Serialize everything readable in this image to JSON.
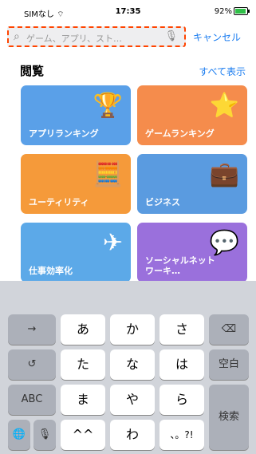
{
  "status": {
    "carrier": "SIMなし",
    "wifi_icon": "wifi-icon",
    "time": "17:35",
    "battery": "92%"
  },
  "search": {
    "placeholder": "ゲーム、アプリ、スト…",
    "cancel_label": "キャンセル"
  },
  "browse": {
    "title": "閲覧",
    "show_all": "すべて表示"
  },
  "categories": [
    {
      "label": "アプリランキング",
      "color": "#5aa0e8"
    },
    {
      "label": "ゲームランキング",
      "color": "#f58c4c"
    },
    {
      "label": "ユーティリティ",
      "color": "#f59a3a"
    },
    {
      "label": "ビジネス",
      "color": "#5a9be0"
    },
    {
      "label": "仕事効率化",
      "color": "#5ca9e8"
    },
    {
      "label": "ソーシャルネットワーキ…",
      "color": "#9a70dc"
    }
  ],
  "keyboard": {
    "row1": [
      "→",
      "あ",
      "か",
      "さ",
      "⌫"
    ],
    "row2": [
      "↺",
      "た",
      "な",
      "は",
      "空白"
    ],
    "row3": [
      "ABC",
      "ま",
      "や",
      "ら",
      "検索"
    ],
    "row4": [
      "🌐",
      "🎙",
      "^^",
      "わ",
      "、。?!"
    ]
  }
}
